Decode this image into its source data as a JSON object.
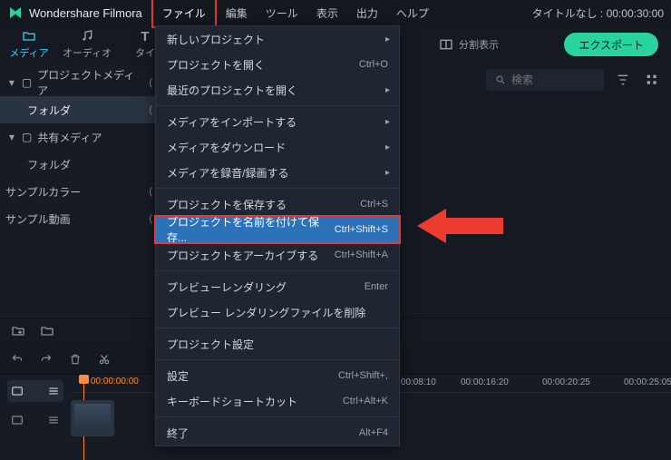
{
  "app_name": "Wondershare Filmora",
  "menu": [
    "ファイル",
    "編集",
    "ツール",
    "表示",
    "出力",
    "ヘルプ"
  ],
  "title_right": "タイトルなし : 00:00:30:00",
  "tabs": {
    "media": "メディア",
    "audio": "オーディオ",
    "title": "タイ",
    "split": "分割表示"
  },
  "export_label": "エクスポート",
  "sidebar": {
    "project_media": "プロジェクトメディア",
    "folder": "フォルダ",
    "shared_media": "共有メディア",
    "folder2": "フォルダ",
    "sample_color": "サンプルカラー",
    "sample_video": "サンプル動画",
    "counts": {
      "project": "(",
      "shared": "("
    }
  },
  "search": {
    "placeholder": "検索"
  },
  "dropdown": {
    "new_project": "新しいプロジェクト",
    "open_project": "プロジェクトを開く",
    "open_project_sc": "Ctrl+O",
    "recent_projects": "最近のプロジェクトを開く",
    "import_media": "メディアをインポートする",
    "download_media": "メディアをダウンロード",
    "record_media": "メディアを録音/録画する",
    "save_project": "プロジェクトを保存する",
    "save_sc": "Ctrl+S",
    "save_as": "プロジェクトを名前を付けて保存...",
    "save_as_sc": "Ctrl+Shift+S",
    "archive": "プロジェクトをアーカイブする",
    "archive_sc": "Ctrl+Shift+A",
    "preview_render": "プレビューレンダリング",
    "preview_sc": "Enter",
    "remove_preview": "プレビュー レンダリングファイルを削除",
    "project_settings": "プロジェクト設定",
    "settings": "設定",
    "settings_sc": "Ctrl+Shift+,",
    "shortcuts": "キーボードショートカット",
    "shortcuts_sc": "Ctrl+Alt+K",
    "exit": "終了",
    "exit_sc": "Alt+F4"
  },
  "timeline": {
    "playhead_tc": "00:00:00:00",
    "ticks": [
      "00:00:08:10",
      "00:00:16:20",
      "00:00:20:25",
      "00:00:25:05"
    ]
  }
}
